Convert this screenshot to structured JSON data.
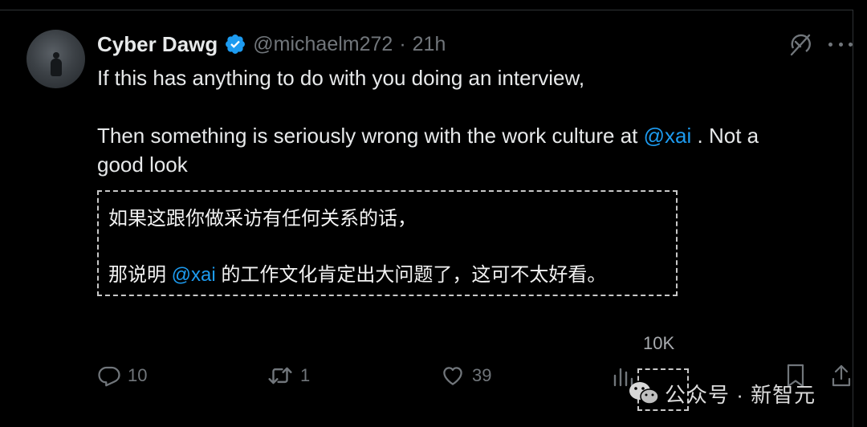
{
  "tweet": {
    "author": {
      "display_name": "Cyber Dawg",
      "handle": "@michaelm272",
      "separator": "·",
      "time": "21h",
      "verified_icon": "verified-badge-icon"
    },
    "text": {
      "line1": "If this has anything to do with you doing an interview,",
      "line2_before": "Then something is seriously wrong with the work culture at ",
      "line2_mention": "@xai",
      "line2_after": " . Not a",
      "line3": "good look"
    },
    "translation": {
      "line1": "如果这跟你做采访有任何关系的话，",
      "line2_before": "那说明 ",
      "line2_mention": "@xai",
      "line2_after": " 的工作文化肯定出大问题了，这可不太好看。"
    },
    "metrics": {
      "views": "10K",
      "replies": "10",
      "reposts": "1",
      "likes": "39"
    }
  },
  "watermark": {
    "text": "公众号 · 新智元"
  },
  "colors": {
    "background": "#000000",
    "text": "#e7e9ea",
    "secondary": "#71767b",
    "accent": "#1d9bf0"
  },
  "icons": [
    "grok-icon",
    "more-icon",
    "reply-icon",
    "retweet-icon",
    "like-icon",
    "views-icon",
    "bookmark-icon",
    "share-icon",
    "wechat-icon"
  ]
}
